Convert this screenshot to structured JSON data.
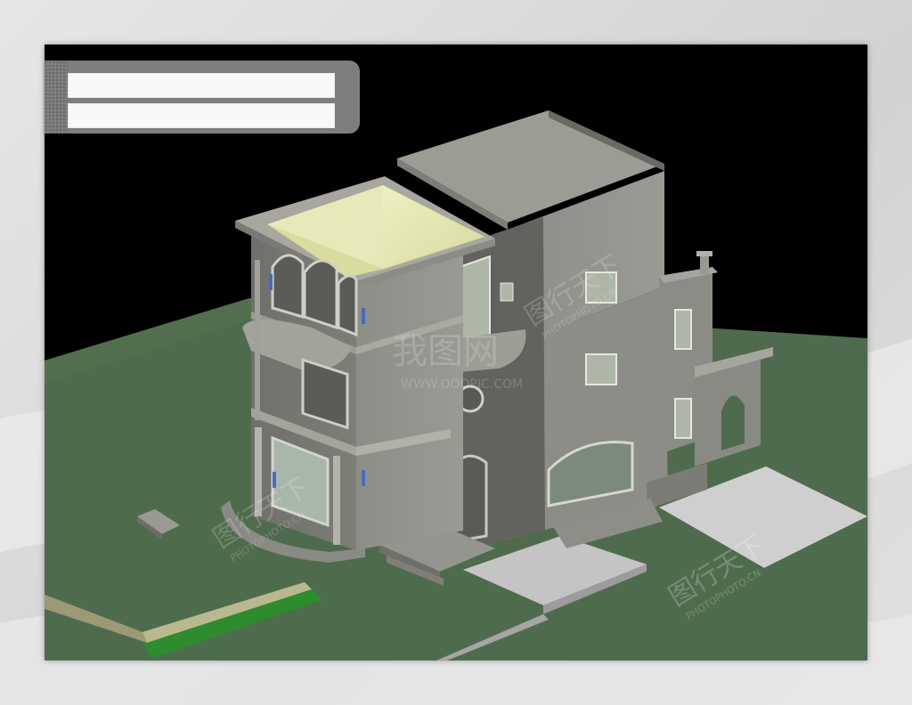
{
  "scene": {
    "kind": "3d-render-viewport",
    "subject": "three-story villa model",
    "background_color": "#000000",
    "ground_color": "#4e6a4c",
    "wall_color": "#8a8a84",
    "roof_color": "#e2e6a6",
    "pavement_color": "#cfcfcf",
    "lawn_strip_color": "#2f8f2f"
  },
  "title_bar": {
    "line1": "",
    "line2": ""
  },
  "watermarks": [
    {
      "text": "我图网",
      "sub": "WWW.OOOPIC.COM"
    },
    {
      "text": "图行天下",
      "sub": "PHOTOPHOTO.CN"
    },
    {
      "text": "图行天下",
      "sub": "PHOTOPHOTO.CN"
    },
    {
      "text": "图行天下",
      "sub": "PHOTOPHOTO.CN"
    }
  ]
}
